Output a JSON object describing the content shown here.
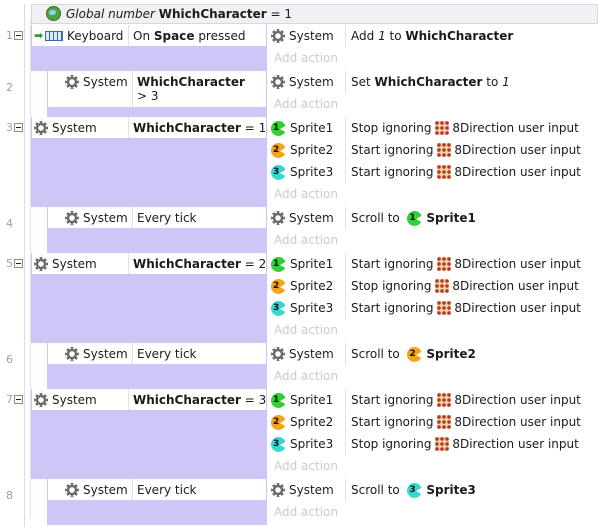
{
  "global_var": {
    "label_prefix": "Global number",
    "name": "WhichCharacter",
    "equals": "= 1"
  },
  "add_action": "Add action",
  "events": [
    {
      "num": "1",
      "cond_obj": "Keyboard",
      "cond_pre": "On",
      "cond_bold": "Space",
      "cond_post": "pressed",
      "actions": [
        {
          "obj": "System",
          "pre": "Add",
          "val_italic": "1",
          "mid": "to",
          "target_bold": "WhichCharacter"
        }
      ]
    },
    {
      "num": "2",
      "cond_obj": "System",
      "cond_bold": "WhichCharacter",
      "cond_post": "> 3",
      "actions": [
        {
          "obj": "System",
          "pre": "Set",
          "target_bold": "WhichCharacter",
          "mid": "to",
          "val_italic": "1"
        }
      ]
    },
    {
      "num": "3",
      "cond_obj": "System",
      "cond_bold": "WhichCharacter",
      "cond_post": "= 1",
      "actions": [
        {
          "obj": "Sprite1",
          "verb": "Stop ignoring",
          "beh": "8Direction user input"
        },
        {
          "obj": "Sprite2",
          "verb": "Start ignoring",
          "beh": "8Direction user input"
        },
        {
          "obj": "Sprite3",
          "verb": "Start ignoring",
          "beh": "8Direction user input"
        }
      ]
    },
    {
      "num": "4",
      "cond_obj": "System",
      "cond_text": "Every tick",
      "actions": [
        {
          "obj": "System",
          "verb": "Scroll to",
          "target": "Sprite1"
        }
      ]
    },
    {
      "num": "5",
      "cond_obj": "System",
      "cond_bold": "WhichCharacter",
      "cond_post": "= 2",
      "actions": [
        {
          "obj": "Sprite1",
          "verb": "Start ignoring",
          "beh": "8Direction user input"
        },
        {
          "obj": "Sprite2",
          "verb": "Stop ignoring",
          "beh": "8Direction user input"
        },
        {
          "obj": "Sprite3",
          "verb": "Start ignoring",
          "beh": "8Direction user input"
        }
      ]
    },
    {
      "num": "6",
      "cond_obj": "System",
      "cond_text": "Every tick",
      "actions": [
        {
          "obj": "System",
          "verb": "Scroll to",
          "target": "Sprite2"
        }
      ]
    },
    {
      "num": "7",
      "cond_obj": "System",
      "cond_bold": "WhichCharacter",
      "cond_post": "= 3",
      "actions": [
        {
          "obj": "Sprite1",
          "verb": "Start ignoring",
          "beh": "8Direction user input"
        },
        {
          "obj": "Sprite2",
          "verb": "Start ignoring",
          "beh": "8Direction user input"
        },
        {
          "obj": "Sprite3",
          "verb": "Stop ignoring",
          "beh": "8Direction user input"
        }
      ]
    },
    {
      "num": "8",
      "cond_obj": "System",
      "cond_text": "Every tick",
      "actions": [
        {
          "obj": "System",
          "verb": "Scroll to",
          "target": "Sprite3"
        }
      ]
    }
  ],
  "sprite_colors": {
    "Sprite1": "#2fd02f",
    "Sprite2": "#f2a51a",
    "Sprite3": "#38d7d2"
  }
}
